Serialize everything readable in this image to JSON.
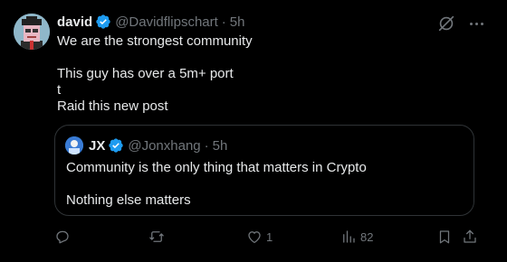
{
  "tweet": {
    "author_name": "david",
    "author_handle": "@Davidflipschart",
    "separator": "·",
    "time": "5h",
    "lines": [
      "We are the strongest community",
      "",
      "This guy has over a 5m+ port",
      "t",
      "Raid this new post"
    ],
    "icons": {
      "grok": "grok-icon",
      "more": "more-icon",
      "verified": "verified-badge-icon"
    }
  },
  "quote": {
    "author_name": "JX",
    "author_handle": "@Jonxhang",
    "separator": "·",
    "time": "5h",
    "lines": [
      "Community is the only thing that matters in Crypto",
      "",
      "Nothing else matters"
    ]
  },
  "actions": {
    "reply": {
      "icon": "reply-icon",
      "count": ""
    },
    "repost": {
      "icon": "repost-icon",
      "count": ""
    },
    "like": {
      "icon": "heart-icon",
      "count": "1"
    },
    "views": {
      "icon": "views-icon",
      "count": "82"
    },
    "bookmark": {
      "icon": "bookmark-icon"
    },
    "share": {
      "icon": "share-icon"
    }
  },
  "colors": {
    "background": "#000000",
    "text": "#e7e9ea",
    "muted": "#71767b",
    "verified": "#1d9bf0",
    "border": "#2f3336"
  }
}
